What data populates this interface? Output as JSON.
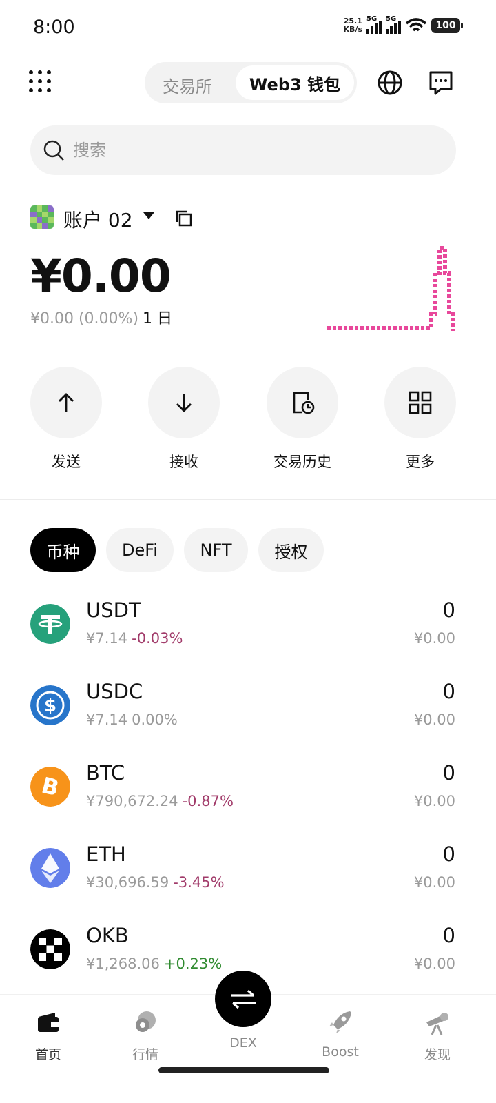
{
  "status_bar": {
    "time": "8:00",
    "net_speed_value": "25.1",
    "net_speed_unit": "KB/s",
    "signal1_label": "5G",
    "signal2_label": "5G",
    "battery": "100"
  },
  "header": {
    "segments": [
      "交易所",
      "Web3 钱包"
    ],
    "active_segment": "Web3 钱包"
  },
  "search": {
    "placeholder": "搜索"
  },
  "account": {
    "name": "账户 02",
    "balance": "¥0.00",
    "change": "¥0.00 (0.00%)",
    "period": "1 日"
  },
  "actions": [
    {
      "label": "发送",
      "icon": "arrow-up-icon"
    },
    {
      "label": "接收",
      "icon": "arrow-down-icon"
    },
    {
      "label": "交易历史",
      "icon": "history-icon"
    },
    {
      "label": "更多",
      "icon": "grid-icon"
    }
  ],
  "chips": [
    "币种",
    "DeFi",
    "NFT",
    "授权"
  ],
  "active_chip": "币种",
  "tokens": [
    {
      "symbol": "USDT",
      "price": "¥7.14",
      "change": "-0.03%",
      "amount": "0",
      "value": "¥0.00",
      "color": "#26a17b"
    },
    {
      "symbol": "USDC",
      "price": "¥7.14",
      "change": "0.00%",
      "amount": "0",
      "value": "¥0.00",
      "color": "#2775ca"
    },
    {
      "symbol": "BTC",
      "price": "¥790,672.24",
      "change": "-0.87%",
      "amount": "0",
      "value": "¥0.00",
      "color": "#f7931a"
    },
    {
      "symbol": "ETH",
      "price": "¥30,696.59",
      "change": "-3.45%",
      "amount": "0",
      "value": "¥0.00",
      "color": "#627eea"
    },
    {
      "symbol": "OKB",
      "price": "¥1,268.06",
      "change": "+0.23%",
      "amount": "0",
      "value": "¥0.00",
      "color": "#000000"
    }
  ],
  "tabbar": {
    "tabs": [
      "首页",
      "行情",
      "DEX",
      "Boost",
      "发现"
    ],
    "active": "首页"
  },
  "colors": {
    "negative": "#a13b6a",
    "positive": "#2f8a2f",
    "accent_sparkline": "#e8489b"
  }
}
